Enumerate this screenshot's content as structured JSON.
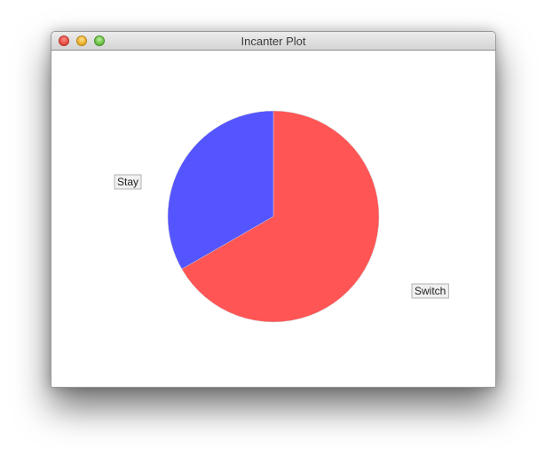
{
  "window": {
    "title": "Incanter Plot"
  },
  "chart_data": {
    "type": "pie",
    "labels": [
      "Switch",
      "Stay"
    ],
    "values": [
      66.7,
      33.3
    ],
    "colors": [
      "#ff5555",
      "#5555ff"
    ],
    "title": ""
  }
}
